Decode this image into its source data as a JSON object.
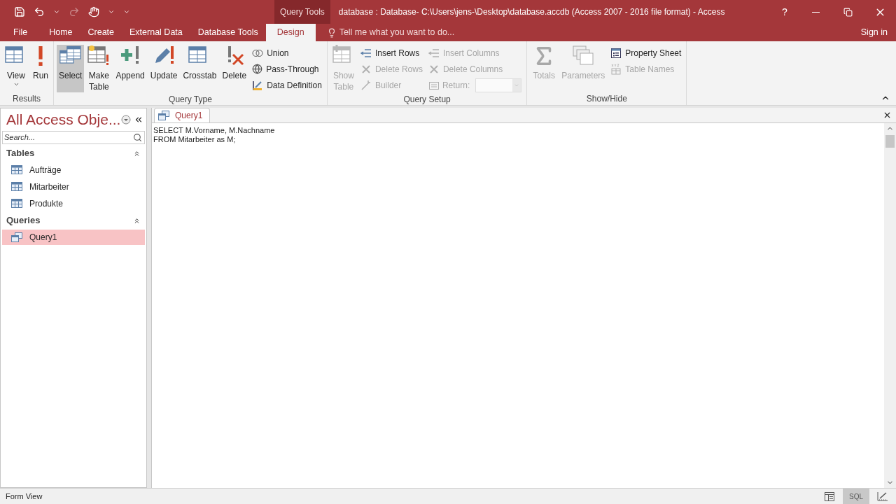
{
  "title_bar": {
    "context_label": "Query Tools",
    "title": "database : Database- C:\\Users\\jens-\\Desktop\\database.accdb (Access 2007 - 2016 file format) - Access",
    "help": "?"
  },
  "ribbon_tabs": [
    {
      "label": "File",
      "selected": false
    },
    {
      "label": "Home",
      "selected": false
    },
    {
      "label": "Create",
      "selected": false
    },
    {
      "label": "External Data",
      "selected": false
    },
    {
      "label": "Database Tools",
      "selected": false
    },
    {
      "label": "Design",
      "selected": true
    }
  ],
  "tell_me": {
    "placeholder": "Tell me what you want to do..."
  },
  "sign_in": "Sign in",
  "ribbon_groups": [
    {
      "label": "Results",
      "commands": [
        {
          "kind": "large",
          "label": "View",
          "disabled": false,
          "selected": false,
          "dropdown": true
        },
        {
          "kind": "large",
          "label": "Run",
          "disabled": false,
          "selected": false
        }
      ]
    },
    {
      "label": "Query Type",
      "commands": [
        {
          "kind": "large",
          "label": "Select",
          "disabled": false,
          "selected": true
        },
        {
          "kind": "large",
          "label": "Make Table",
          "disabled": false,
          "selected": false
        },
        {
          "kind": "large",
          "label": "Append",
          "disabled": false,
          "selected": false
        },
        {
          "kind": "large",
          "label": "Update",
          "disabled": false,
          "selected": false
        },
        {
          "kind": "large",
          "label": "Crosstab",
          "disabled": false,
          "selected": false
        },
        {
          "kind": "large",
          "label": "Delete",
          "disabled": false,
          "selected": false
        },
        {
          "kind": "small",
          "label": "Union",
          "disabled": false
        },
        {
          "kind": "small",
          "label": "Pass-Through",
          "disabled": false
        },
        {
          "kind": "small",
          "label": "Data Definition",
          "disabled": false
        }
      ]
    },
    {
      "label": "Query Setup",
      "commands": [
        {
          "kind": "large",
          "label": "Show Table",
          "disabled": true,
          "selected": false
        },
        {
          "kind": "small",
          "label": "Insert Rows",
          "disabled": false
        },
        {
          "kind": "small",
          "label": "Delete Rows",
          "disabled": true
        },
        {
          "kind": "small",
          "label": "Builder",
          "disabled": true
        },
        {
          "kind": "small",
          "label": "Insert Columns",
          "disabled": true
        },
        {
          "kind": "small",
          "label": "Delete Columns",
          "disabled": true
        },
        {
          "kind": "combo",
          "label": "Return:",
          "disabled": true
        }
      ]
    },
    {
      "label": "Show/Hide",
      "commands": [
        {
          "kind": "large",
          "label": "Totals",
          "disabled": true,
          "selected": false
        },
        {
          "kind": "large",
          "label": "Parameters",
          "disabled": true,
          "selected": false
        },
        {
          "kind": "small",
          "label": "Property Sheet",
          "disabled": false
        },
        {
          "kind": "small",
          "label": "Table Names",
          "disabled": true
        }
      ]
    }
  ],
  "nav_pane": {
    "title": "All Access Obje...",
    "search": {
      "placeholder": "Search..."
    },
    "sections": [
      {
        "label": "Tables",
        "expanded": true,
        "items": [
          {
            "label": "Aufträge",
            "selected": false
          },
          {
            "label": "Mitarbeiter",
            "selected": false
          },
          {
            "label": "Produkte",
            "selected": false
          }
        ]
      },
      {
        "label": "Queries",
        "expanded": true,
        "items": [
          {
            "label": "Query1",
            "selected": true
          }
        ]
      }
    ]
  },
  "document": {
    "tab": {
      "label": "Query1",
      "selected": true
    },
    "sql_lines": [
      "SELECT M.Vorname, M.Nachname",
      "FROM Mitarbeiter as M;"
    ]
  },
  "status_bar": {
    "text": "Form View",
    "views": [
      {
        "kind": "datasheet",
        "selected": false
      },
      {
        "kind": "sql",
        "label": "SQL",
        "selected": true
      },
      {
        "kind": "design",
        "selected": false
      }
    ]
  }
}
